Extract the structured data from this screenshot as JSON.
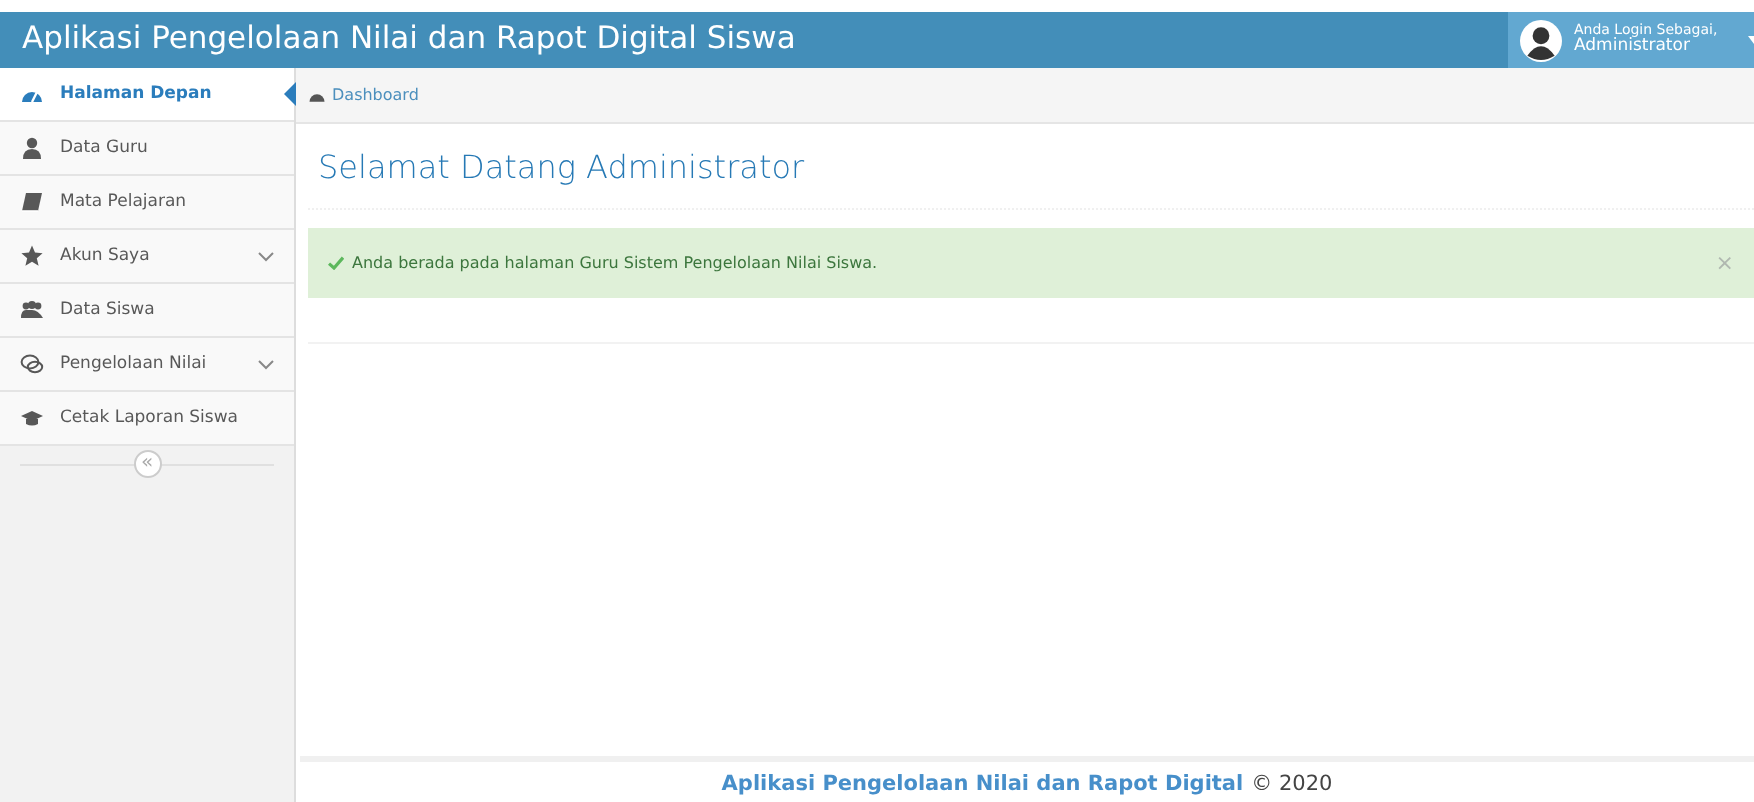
{
  "header": {
    "title": "Aplikasi Pengelolaan Nilai dan Rapot Digital Siswa",
    "user_caption": "Anda Login Sebagai,",
    "user_name": "Administrator"
  },
  "sidebar": {
    "items": [
      {
        "label": "Halaman Depan",
        "kind": "dashboard",
        "selected": true,
        "expandable": false
      },
      {
        "label": "Data Guru",
        "kind": "user",
        "selected": false,
        "expandable": false
      },
      {
        "label": "Mata Pelajaran",
        "kind": "book",
        "selected": false,
        "expandable": false
      },
      {
        "label": "Akun Saya",
        "kind": "star",
        "selected": false,
        "expandable": true
      },
      {
        "label": "Data Siswa",
        "kind": "users",
        "selected": false,
        "expandable": false
      },
      {
        "label": "Pengelolaan Nilai",
        "kind": "comments",
        "selected": false,
        "expandable": true
      },
      {
        "label": "Cetak Laporan Siswa",
        "kind": "cap",
        "selected": false,
        "expandable": false
      }
    ],
    "collapse": "«"
  },
  "breadcrumb": [
    "Dashboard"
  ],
  "page_title": "Selamat Datang Administrator",
  "alert": {
    "message": "Anda berada pada halaman Guru Sistem Pengelolaan Nilai Siswa.",
    "close": "×"
  },
  "footer": {
    "app_name": "Aplikasi Pengelolaan Nilai dan Rapot Digital",
    "copyright": "© 2020"
  }
}
